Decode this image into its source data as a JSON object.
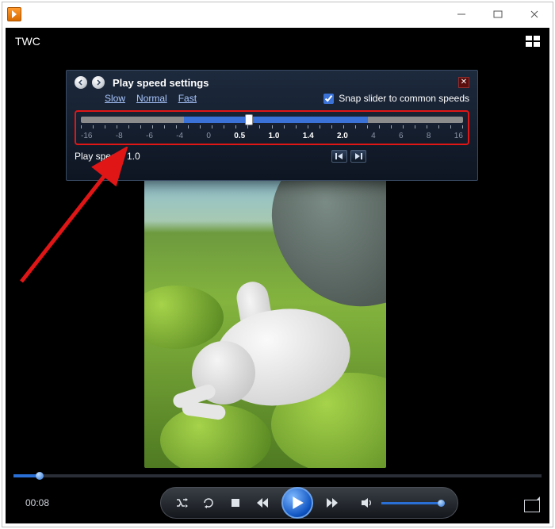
{
  "watermark": "TWC",
  "panel": {
    "title": "Play speed settings",
    "links": {
      "slow": "Slow",
      "normal": "Normal",
      "fast": "Fast"
    },
    "snap_label": "Snap slider to common speeds",
    "snap_checked": true,
    "ticks": [
      "-16",
      "-8",
      "-6",
      "-4",
      "0",
      "0.5",
      "1.0",
      "1.4",
      "2.0",
      "4",
      "6",
      "8",
      "16"
    ],
    "boldTicks": [
      5,
      6,
      7,
      8
    ],
    "blue_start_pct": 27,
    "blue_end_pct": 75,
    "thumb_pct": 44,
    "speed_label": "Play speed: 1.0"
  },
  "playback": {
    "time": "00:08",
    "seek_pct": 5,
    "volume_pct": 97
  }
}
